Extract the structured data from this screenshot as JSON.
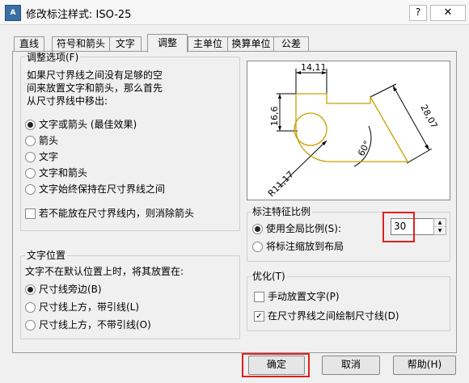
{
  "window": {
    "app_icon_text": "A",
    "title": "修改标注样式: ISO-25",
    "help_label": "?",
    "close_label": "✕"
  },
  "tabs": [
    {
      "label": "直线"
    },
    {
      "label": "符号和箭头"
    },
    {
      "label": "文字"
    },
    {
      "label": "调整"
    },
    {
      "label": "主单位"
    },
    {
      "label": "换算单位"
    },
    {
      "label": "公差"
    }
  ],
  "fit_options": {
    "legend": "调整选项(F)",
    "description": [
      "如果尺寸界线之间没有足够的空",
      "间来放置文字和箭头，那么首先",
      "从尺寸界线中移出:"
    ],
    "radios": [
      {
        "label": "文字或箭头 (最佳效果)",
        "selected": true
      },
      {
        "label": "箭头",
        "selected": false
      },
      {
        "label": "文字",
        "selected": false
      },
      {
        "label": "文字和箭头",
        "selected": false
      },
      {
        "label": "文字始终保持在尺寸界线之间",
        "selected": false
      }
    ],
    "suppress_checkbox": {
      "label": "若不能放在尺寸界线内，则消除箭头",
      "checked": false
    }
  },
  "text_placement": {
    "legend": "文字位置",
    "description": "文字不在默认位置上时，将其放置在:",
    "radios": [
      {
        "label": "尺寸线旁边(B)",
        "selected": true
      },
      {
        "label": "尺寸线上方，带引线(L)",
        "selected": false
      },
      {
        "label": "尺寸线上方，不带引线(O)",
        "selected": false
      }
    ]
  },
  "preview": {
    "dim_top": "14,11",
    "dim_left": "16,6",
    "dim_right": "28,07",
    "dim_angle": "60°",
    "dim_radius": "R11,17"
  },
  "scale": {
    "legend": "标注特征比例",
    "use_overall_label": "使用全局比例(S):",
    "use_overall_selected": true,
    "overall_value": "30",
    "scale_to_layout_label": "将标注缩放到布局",
    "scale_to_layout_selected": false
  },
  "fine_tuning": {
    "legend": "优化(T)",
    "manual_text": {
      "label": "手动放置文字(P)",
      "checked": false
    },
    "draw_dim_line": {
      "label": "在尺寸界线之间绘制尺寸线(D)",
      "checked": true
    }
  },
  "buttons": {
    "ok": "确定",
    "cancel": "取消",
    "help": "帮助(H)"
  },
  "colors": {
    "highlight_red": "#e02020",
    "preview_outline": "#c8a000"
  }
}
